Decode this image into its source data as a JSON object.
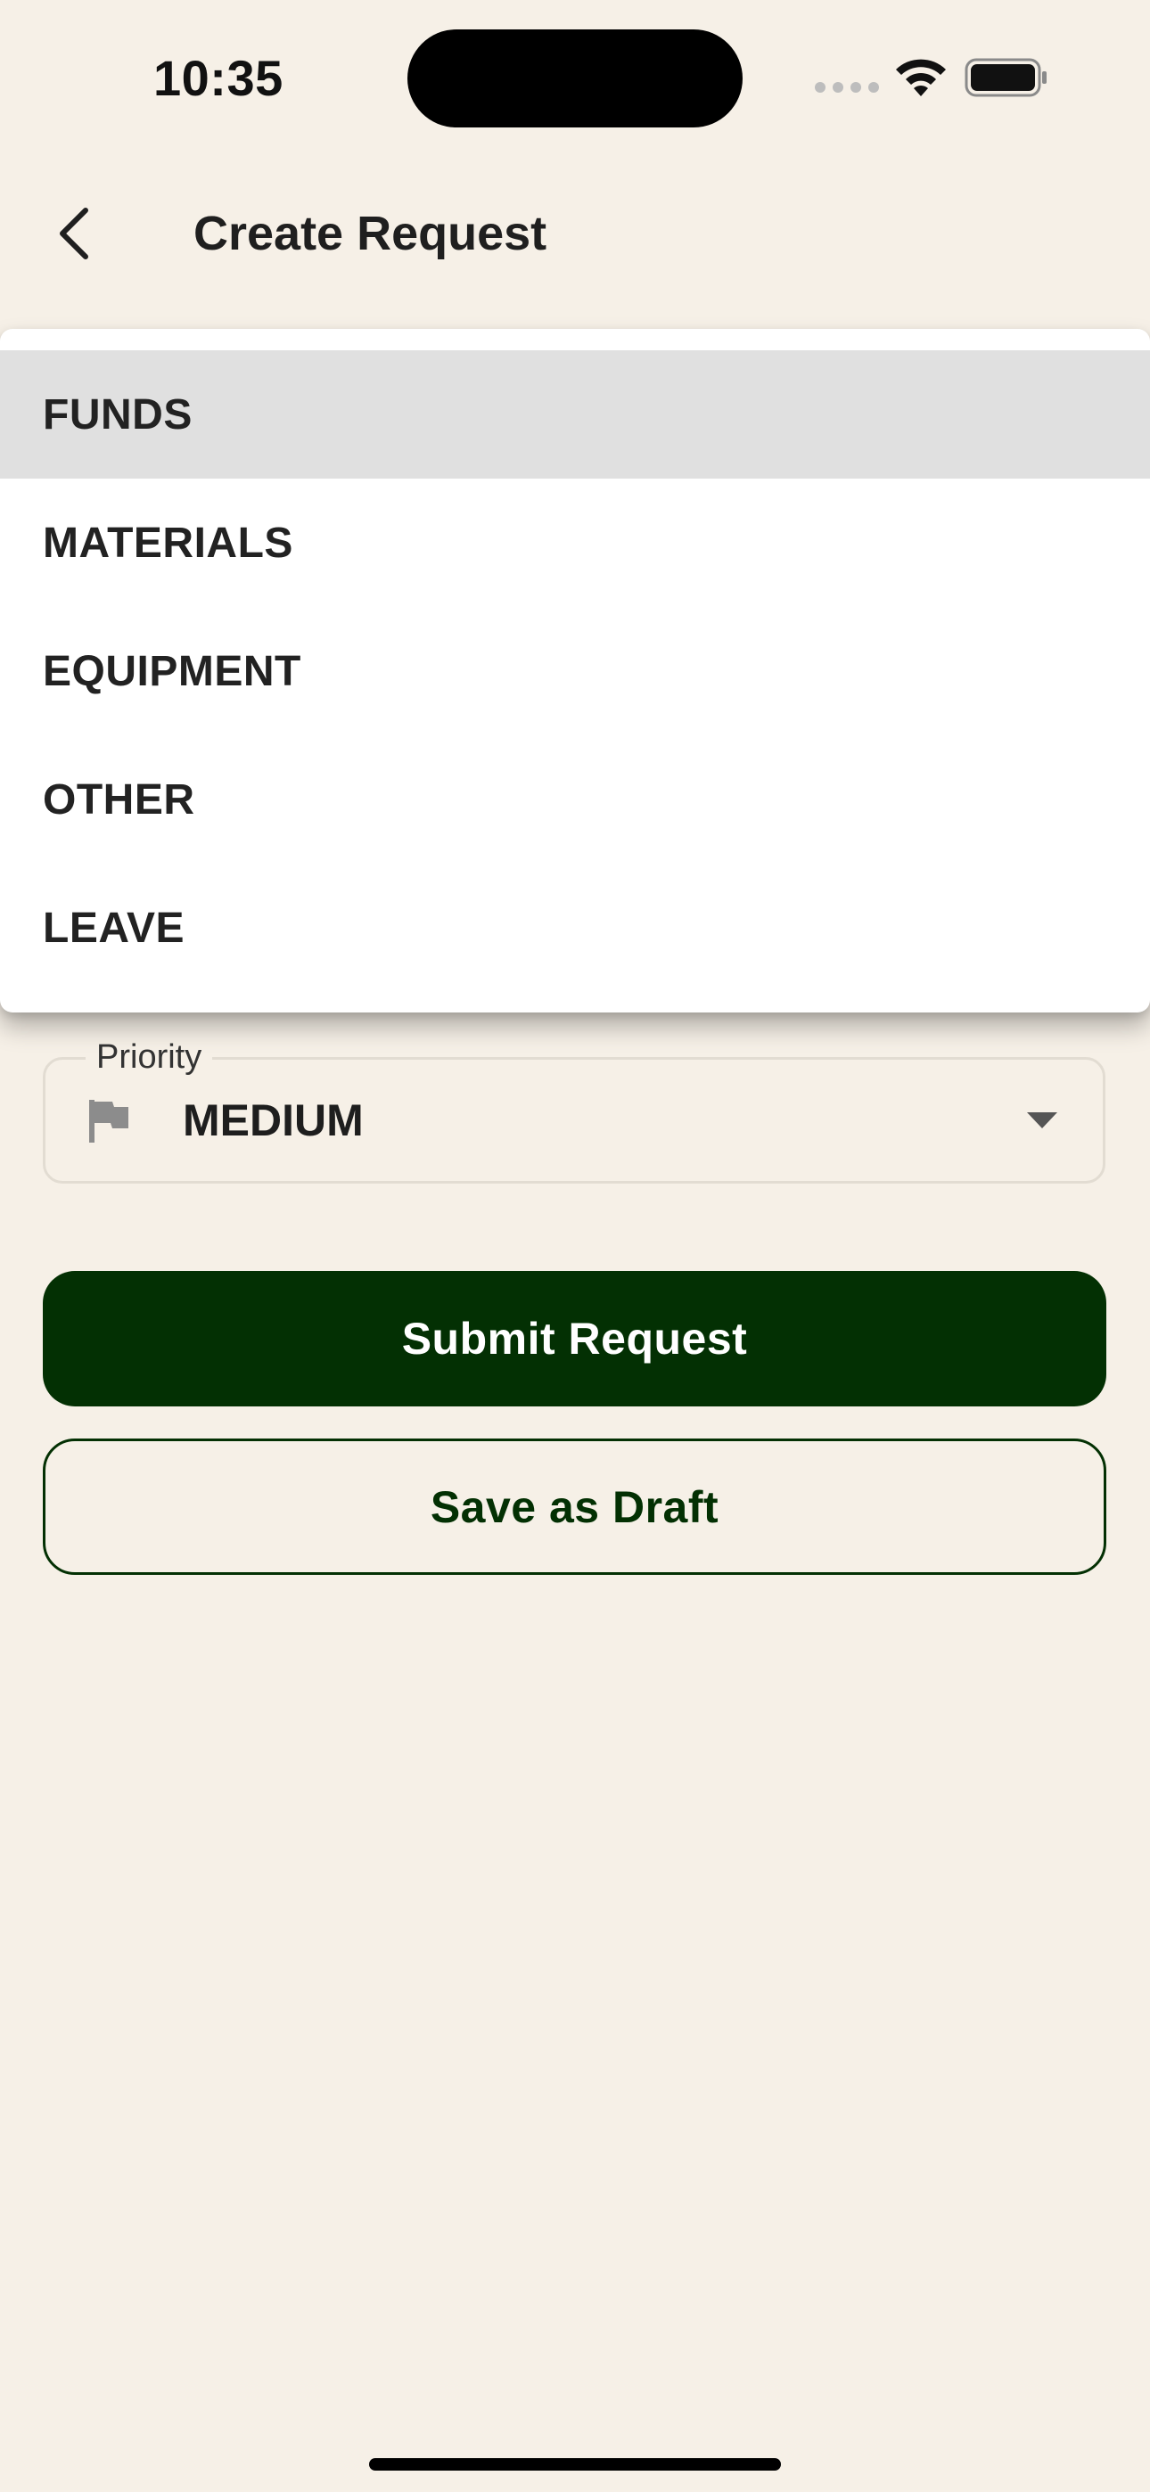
{
  "status_bar": {
    "time": "10:35",
    "signal_icon": "signal-dots-icon",
    "wifi_icon": "wifi-icon",
    "battery_icon": "battery-icon"
  },
  "header": {
    "back_icon": "chevron-left-icon",
    "title": "Create Request"
  },
  "category_menu": {
    "options": [
      {
        "label": "FUNDS",
        "selected": true
      },
      {
        "label": "MATERIALS",
        "selected": false
      },
      {
        "label": "EQUIPMENT",
        "selected": false
      },
      {
        "label": "OTHER",
        "selected": false
      },
      {
        "label": "LEAVE",
        "selected": false
      }
    ]
  },
  "priority": {
    "label": "Priority",
    "value": "MEDIUM",
    "icon": "flag-icon"
  },
  "actions": {
    "submit_label": "Submit Request",
    "draft_label": "Save as Draft"
  },
  "colors": {
    "background": "#F6F0E7",
    "primary": "#033003",
    "menu_selected": "#E0E0E0"
  }
}
